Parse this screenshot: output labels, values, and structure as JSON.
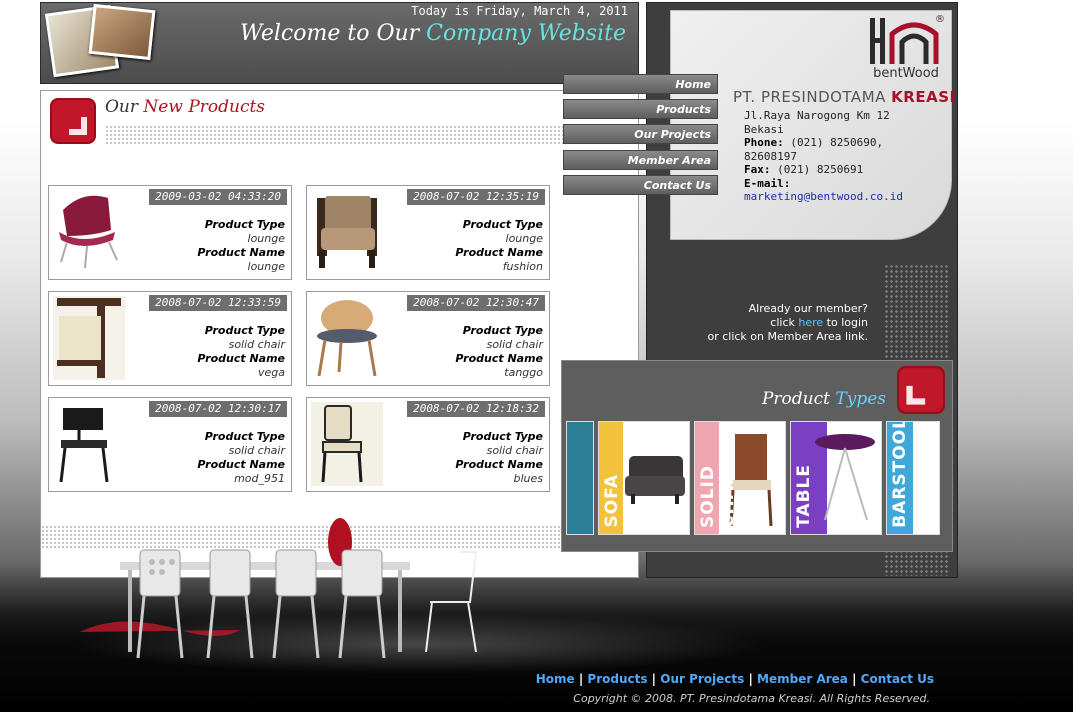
{
  "header": {
    "date_text": "Today is Friday, March 4, 2011",
    "welcome_prefix": "Welcome to Our ",
    "welcome_highlight": "Company Website"
  },
  "new_products": {
    "title_prefix": "Our ",
    "title_highlight": "New Products",
    "type_label": "Product Type",
    "name_label": "Product Name",
    "items": [
      {
        "timestamp": "2009-03-02 04:33:20",
        "type": "lounge",
        "name": "lounge"
      },
      {
        "timestamp": "2008-07-02 12:35:19",
        "type": "lounge",
        "name": "fushion"
      },
      {
        "timestamp": "2008-07-02 12:33:59",
        "type": "solid chair",
        "name": "vega"
      },
      {
        "timestamp": "2008-07-02 12:30:47",
        "type": "solid chair",
        "name": "tanggo"
      },
      {
        "timestamp": "2008-07-02 12:30:17",
        "type": "solid chair",
        "name": "mod_951"
      },
      {
        "timestamp": "2008-07-02 12:18:32",
        "type": "solid chair",
        "name": "blues"
      }
    ]
  },
  "nav": [
    "Home",
    "Products",
    "Our Projects",
    "Member Area",
    "Contact Us"
  ],
  "contact": {
    "logo_text": "bentWood",
    "registered": "®",
    "company_prefix": "PT. PRESINDOTAMA ",
    "company_highlight": "KREASI",
    "address1": "Jl.Raya Narogong Km 12",
    "address2": "Bekasi",
    "phone_label": "Phone:",
    "phone_value": "(021) 8250690,",
    "phone_value2": "82608197",
    "fax_label": "Fax:",
    "fax_value": "(021) 8250691",
    "email_label": "E-mail:",
    "email_value": "marketing@bentwood.co.id"
  },
  "member": {
    "line1": "Already our member?",
    "line2_pre": "click ",
    "line2_link": "here",
    "line2_post": " to login",
    "line3": "or click on Member Area link."
  },
  "product_types": {
    "title_prefix": "Product ",
    "title_highlight": "Types",
    "tiles": [
      {
        "label": "SOFA",
        "color": "#f2c23a"
      },
      {
        "label": "SOLID CHAIR",
        "color": "#f0a6b0"
      },
      {
        "label": "TABLE",
        "color": "#7a3fc2"
      },
      {
        "label": "BARSTOOL",
        "color": "#3fa8d8"
      }
    ]
  },
  "footer": {
    "links": [
      "Home",
      "Products",
      "Our Projects",
      "Member Area",
      "Contact Us"
    ],
    "separator": " | ",
    "copyright": "Copyright © 2008. PT. Presindotama Kreasi. All Rights Reserved."
  },
  "colors": {
    "accent_red": "#b01020",
    "accent_cyan": "#66e3e0",
    "link_blue": "#4fa9ff"
  }
}
